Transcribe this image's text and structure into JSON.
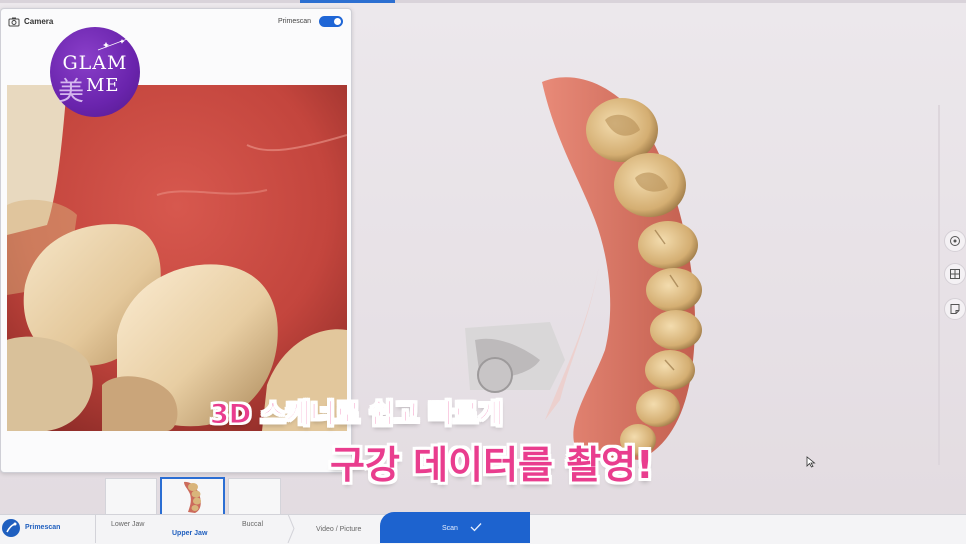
{
  "camera_panel": {
    "title": "Camera",
    "toggle_label": "Primescan",
    "toggle_on": true
  },
  "logo": {
    "line1": "GLAM",
    "line2": "ME",
    "hanja": "美"
  },
  "captions": {
    "line1": "3D 스캐너로 쉽고 빠르게",
    "line2": "구강 데이터를 촬영!"
  },
  "bottom_bar": {
    "brand_label": "Primescan",
    "steps": [
      "Lower Jaw",
      "Upper Jaw",
      "Buccal",
      "Video / Picture"
    ],
    "active_step": "Upper Jaw",
    "scan_label": "Scan"
  },
  "colors": {
    "accent": "#1f66d6",
    "caption_pink": "#e93d8e",
    "logo_purple": "#6a24ad"
  },
  "icons": [
    "camera-icon",
    "tooth-icon",
    "grid-icon",
    "note-icon",
    "check-icon",
    "cursor-icon"
  ]
}
